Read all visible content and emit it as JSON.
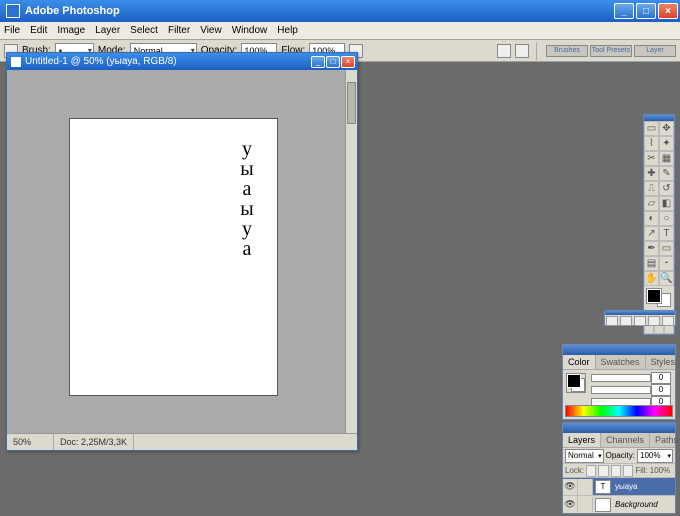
{
  "app": {
    "title": "Adobe Photoshop"
  },
  "menu": {
    "items": [
      "File",
      "Edit",
      "Image",
      "Layer",
      "Select",
      "Filter",
      "View",
      "Window",
      "Help"
    ]
  },
  "options": {
    "brush": "Brush:",
    "brush_val": "•",
    "mode": "Mode:",
    "mode_val": "Normal",
    "opacity": "Opacity:",
    "opacity_val": "100%",
    "flow": "Flow:",
    "flow_val": "100%"
  },
  "shelf": [
    "Brushes",
    "Tool Presets",
    "Layer Comps"
  ],
  "doc": {
    "title": "Untitled-1 @ 50% (уыауа, RGB/8)",
    "zoom": "50%",
    "docinfo": "Doc: 2,25M/3,3K",
    "text": "у\nы\nа\nы\nу\nа"
  },
  "colorp": {
    "tabs": [
      "Color",
      "Swatches",
      "Styles"
    ],
    "r": "0",
    "g": "0",
    "b": "0"
  },
  "layersp": {
    "tabs": [
      "Layers",
      "Channels",
      "Paths"
    ],
    "blend": "Normal",
    "opacity_lbl": "Opacity:",
    "opacity": "100%",
    "lock": "Lock:",
    "fill_lbl": "Fill:",
    "fill": "100%",
    "layers": [
      {
        "name": "уыауа",
        "thumb": "T",
        "selected": true
      },
      {
        "name": "Background",
        "thumb": "",
        "selected": false
      }
    ]
  }
}
